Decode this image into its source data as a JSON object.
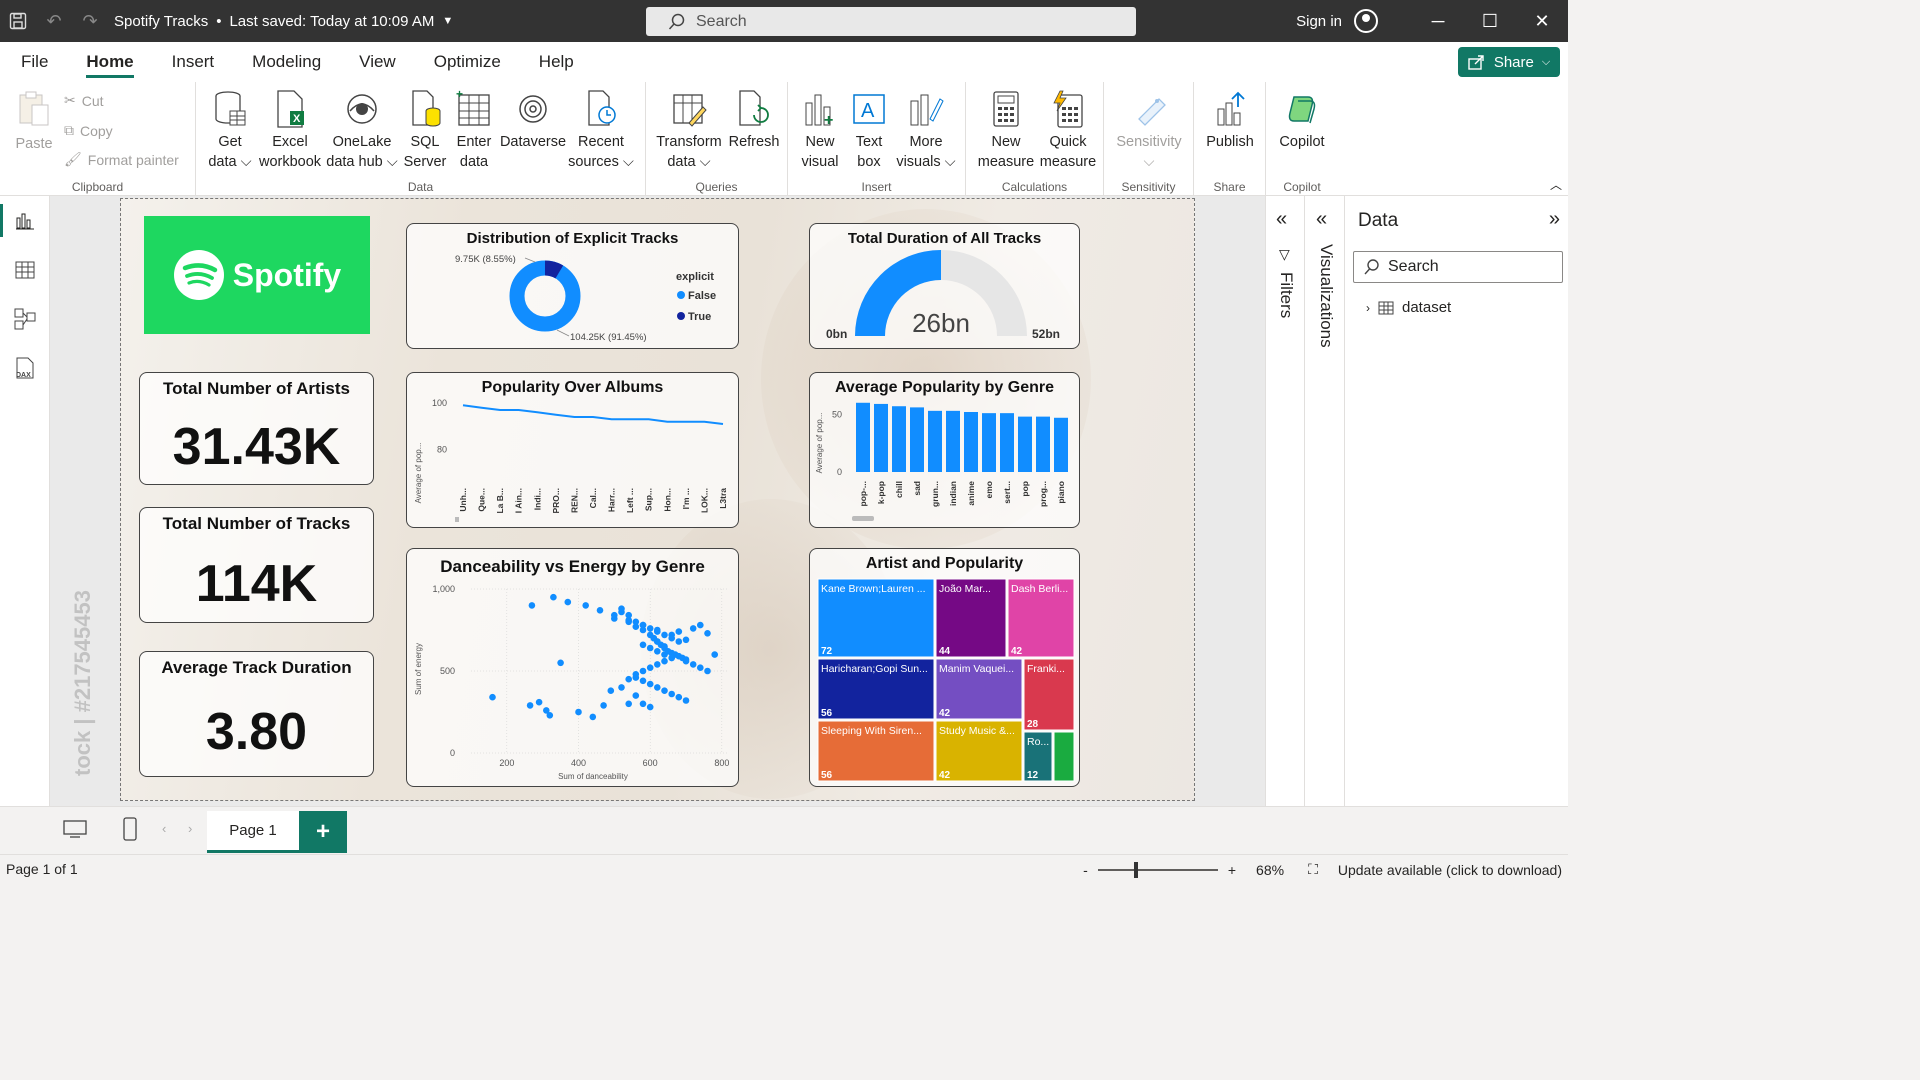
{
  "titlebar": {
    "title": "Spotify Tracks",
    "saved": "Last saved: Today at 10:09 AM",
    "search_placeholder": "Search",
    "signin": "Sign in"
  },
  "menu": {
    "items": [
      "File",
      "Home",
      "Insert",
      "Modeling",
      "View",
      "Optimize",
      "Help"
    ],
    "active": "Home",
    "share": "Share"
  },
  "ribbon": {
    "clipboard": {
      "paste": "Paste",
      "cut": "Cut",
      "copy": "Copy",
      "format_painter": "Format painter",
      "label": "Clipboard"
    },
    "data": {
      "get_data": [
        "Get",
        "data"
      ],
      "excel": [
        "Excel",
        "workbook"
      ],
      "onelake": [
        "OneLake",
        "data hub"
      ],
      "sql": [
        "SQL",
        "Server"
      ],
      "enter": [
        "Enter",
        "data"
      ],
      "dataverse": "Dataverse",
      "recent": [
        "Recent",
        "sources"
      ],
      "label": "Data"
    },
    "queries": {
      "transform": [
        "Transform",
        "data"
      ],
      "refresh": "Refresh",
      "label": "Queries"
    },
    "insert": {
      "new_visual": [
        "New",
        "visual"
      ],
      "text_box": [
        "Text",
        "box"
      ],
      "more_visuals": [
        "More",
        "visuals"
      ],
      "label": "Insert"
    },
    "calculations": {
      "new_measure": [
        "New",
        "measure"
      ],
      "quick_measure": [
        "Quick",
        "measure"
      ],
      "label": "Calculations"
    },
    "sensitivity": {
      "btn": "Sensitivity",
      "label": "Sensitivity"
    },
    "share": {
      "publish": "Publish",
      "label": "Share"
    },
    "copilot": {
      "btn": "Copilot",
      "label": "Copilot"
    }
  },
  "report": {
    "logo_text": "Spotify",
    "watermark": "tock | #217545453",
    "kpis": [
      {
        "title": "Total Number of Artists",
        "value": "31.43K"
      },
      {
        "title": "Total Number of Tracks",
        "value": "114K"
      },
      {
        "title": "Average Track Duration",
        "value": "3.80"
      }
    ],
    "donut": {
      "title": "Distribution of Explicit Tracks",
      "legend_title": "explicit",
      "legend": [
        "False",
        "True"
      ],
      "label_true": "9.75K (8.55%)",
      "label_false": "104.25K (91.45%)",
      "colors": [
        "#118dff",
        "#12239e"
      ]
    },
    "gauge": {
      "title": "Total Duration of All Tracks",
      "value_label": "26bn",
      "min": "0bn",
      "max": "52bn",
      "fill_fraction": 0.5
    },
    "line": {
      "title": "Popularity Over Albums",
      "ylabel": "Average of pop..."
    },
    "bar": {
      "title": "Average Popularity by Genre",
      "ylabel": "Average of pop..."
    },
    "scatter": {
      "title": "Danceability vs Energy by Genre",
      "xlabel": "Sum of danceability",
      "ylabel": "Sum of energy"
    },
    "treemap": {
      "title": "Artist and Popularity",
      "cells": [
        {
          "label": "Kane Brown;Lauren ...",
          "value": "72",
          "color": "#118dff"
        },
        {
          "label": "João Mar...",
          "value": "44",
          "color": "#750985"
        },
        {
          "label": "Dash Berli...",
          "value": "42",
          "color": "#e044a7"
        },
        {
          "label": "Haricharan;Gopi Sun...",
          "value": "56",
          "color": "#12239e"
        },
        {
          "label": "Manim Vaquei...",
          "value": "42",
          "color": "#744ec2"
        },
        {
          "label": "Franki...",
          "value": "28",
          "color": "#d9394e"
        },
        {
          "label": "Sleeping With Siren...",
          "value": "56",
          "color": "#e66c37"
        },
        {
          "label": "Study Music &...",
          "value": "42",
          "color": "#d9b300"
        },
        {
          "label": "Ro...",
          "value": "12",
          "color": "#197278"
        },
        {
          "label": "",
          "value": "",
          "color": "#1aab40"
        }
      ]
    }
  },
  "chart_data": [
    {
      "type": "pie",
      "title": "Distribution of Explicit Tracks",
      "categories": [
        "False",
        "True"
      ],
      "values": [
        104250,
        9750
      ],
      "legend_title": "explicit"
    },
    {
      "type": "line",
      "title": "Popularity Over Albums",
      "ylabel": "Average of pop...",
      "categories": [
        "Unh...",
        "Que...",
        "La B...",
        "I Ain...",
        "Indi...",
        "PRO...",
        "REN...",
        "Cal...",
        "Harr...",
        "Left ...",
        "Sup...",
        "Hon...",
        "I'm ...",
        "LOK...",
        "L3tra"
      ],
      "values": [
        99,
        98,
        97,
        97,
        96,
        95,
        94,
        94,
        93,
        93,
        93,
        92,
        92,
        92,
        91
      ],
      "ylim": [
        70,
        100
      ],
      "yticks": [
        80,
        100
      ]
    },
    {
      "type": "bar",
      "title": "Average Popularity by Genre",
      "ylabel": "Average of pop...",
      "categories": [
        "pop-...",
        "k-pop",
        "chill",
        "sad",
        "grun...",
        "indian",
        "anime",
        "emo",
        "sert...",
        "pop",
        "prog...",
        "piano"
      ],
      "values": [
        60,
        59,
        57,
        56,
        53,
        53,
        52,
        51,
        51,
        48,
        48,
        47
      ],
      "ylim": [
        0,
        65
      ],
      "yticks": [
        0,
        50
      ]
    },
    {
      "type": "scatter",
      "title": "Danceability vs Energy by Genre",
      "xlabel": "Sum of danceability",
      "ylabel": "Sum of energy",
      "xlim": [
        100,
        820
      ],
      "ylim": [
        0,
        1000
      ],
      "xticks": [
        200,
        400,
        600,
        800
      ],
      "yticks": [
        0,
        500,
        1000
      ],
      "x": [
        160,
        270,
        330,
        370,
        350,
        290,
        265,
        310,
        320,
        400,
        440,
        470,
        490,
        520,
        540,
        560,
        580,
        600,
        610,
        620,
        640,
        660,
        680,
        700,
        720,
        740,
        760,
        780,
        500,
        520,
        540,
        560,
        580,
        600,
        610,
        620,
        630,
        640,
        650,
        660,
        670,
        680,
        690,
        700,
        520,
        540,
        560,
        580,
        600,
        620,
        640,
        660,
        680,
        580,
        600,
        620,
        640,
        660,
        700,
        720,
        740,
        760,
        560,
        580,
        600,
        620,
        640,
        660,
        680,
        700,
        540,
        560,
        580,
        600,
        620,
        640,
        660,
        420,
        460,
        500,
        540,
        580,
        620
      ],
      "y": [
        340,
        900,
        950,
        920,
        550,
        310,
        290,
        260,
        230,
        250,
        220,
        290,
        380,
        400,
        450,
        350,
        300,
        280,
        700,
        680,
        650,
        720,
        740,
        690,
        760,
        780,
        730,
        600,
        820,
        860,
        800,
        770,
        750,
        720,
        700,
        680,
        660,
        640,
        620,
        610,
        600,
        590,
        580,
        570,
        880,
        840,
        800,
        780,
        760,
        740,
        720,
        700,
        680,
        660,
        640,
        620,
        600,
        580,
        560,
        540,
        520,
        500,
        460,
        440,
        420,
        400,
        380,
        360,
        340,
        320,
        300,
        480,
        500,
        520,
        540,
        560,
        580,
        900,
        870,
        840,
        810,
        780,
        750
      ]
    },
    {
      "type": "heatmap",
      "title": "Artist and Popularity",
      "categories": [
        "Kane Brown;Lauren ...",
        "João Mar...",
        "Dash Berli...",
        "Haricharan;Gopi Sun...",
        "Manim Vaquei...",
        "Franki...",
        "Sleeping With Siren...",
        "Study Music &...",
        "Ro..."
      ],
      "values": [
        72,
        44,
        42,
        56,
        42,
        28,
        56,
        42,
        12
      ]
    },
    {
      "type": "bar",
      "title": "Total Duration of All Tracks",
      "values": [
        26
      ],
      "ylim": [
        0,
        52
      ]
    }
  ],
  "rightpane": {
    "filters": "Filters",
    "visualizations": "Visualizations",
    "data_title": "Data",
    "search_placeholder": "Search",
    "item": "dataset"
  },
  "pagebar": {
    "page": "Page 1",
    "add": "+"
  },
  "status": {
    "left": "Page 1 of 1",
    "zoom": "68%",
    "update": "Update available (click to download)"
  }
}
